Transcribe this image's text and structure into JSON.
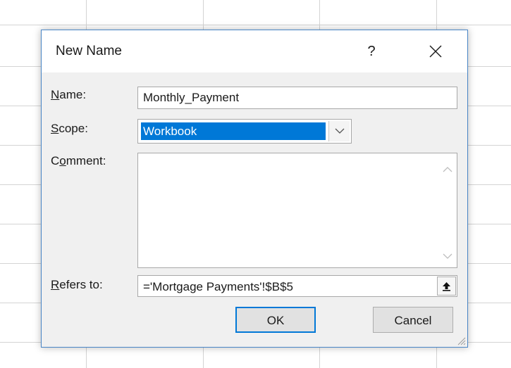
{
  "dialog": {
    "title": "New Name",
    "help_label": "?",
    "close_icon": "close-icon"
  },
  "fields": {
    "name": {
      "label_accel": "N",
      "label_rest": "ame:",
      "value": "Monthly_Payment"
    },
    "scope": {
      "label_accel": "S",
      "label_rest": "cope:",
      "value": "Workbook"
    },
    "comment": {
      "label_pre": "C",
      "label_accel": "o",
      "label_rest": "mment:",
      "value": ""
    },
    "refers_to": {
      "label_accel": "R",
      "label_rest": "efers to:",
      "value": "='Mortgage Payments'!$B$5"
    }
  },
  "buttons": {
    "ok_label": "OK",
    "cancel_label": "Cancel"
  },
  "colors": {
    "accent": "#0078d7",
    "dialog_border": "#4a86c6",
    "dialog_bg": "#f0f0f0"
  }
}
